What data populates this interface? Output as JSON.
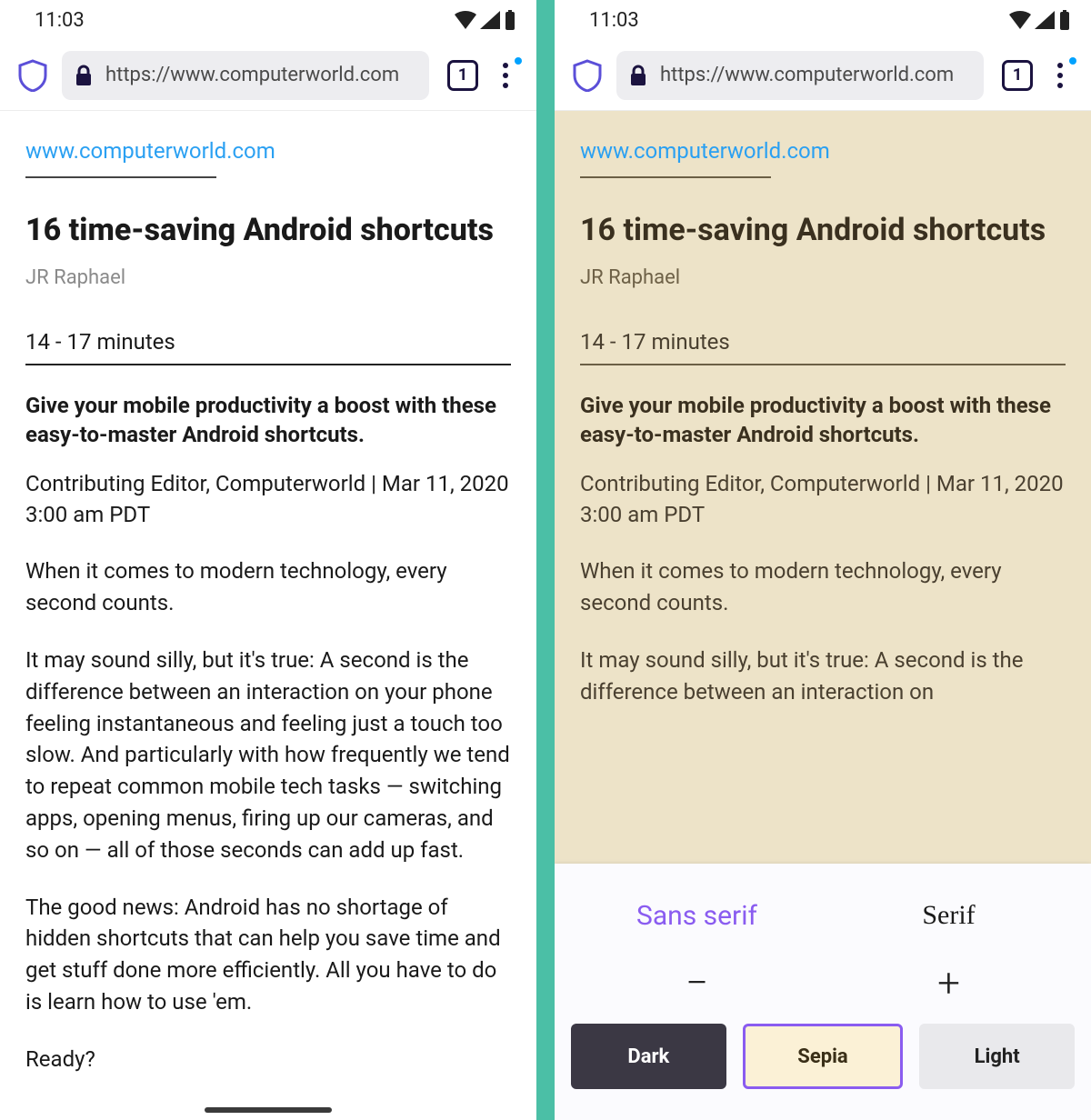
{
  "status": {
    "time": "11:03"
  },
  "toolbar": {
    "url": "https://www.computerworld.com",
    "tab_count": "1"
  },
  "article": {
    "site_link": "www.computerworld.com",
    "title": "16 time-saving Android shortcuts",
    "author": "JR Raphael",
    "read_time": "14 - 17 minutes",
    "subhead": "Give your mobile productivity a boost with these easy-to-master Android shortcuts.",
    "meta": "Contributing Editor, Computerworld | Mar 11, 2020 3:00 am PDT",
    "p1": "When it comes to modern technology, every second counts.",
    "p2": "It may sound silly, but it's true: A second is the difference between an interaction on your phone feeling instantaneous and feeling just a touch too slow. And particularly with how frequently we tend to repeat common mobile tech tasks — switching apps, opening menus, firing up our cameras, and so on — all of those seconds can add up fast.",
    "p2_short": "It may sound silly, but it's true: A second is the difference between an interaction on",
    "p3": "The good news: Android has no shortage of hidden shortcuts that can help you save time and get stuff done more efficiently. All you have to do is learn how to use 'em.",
    "p4": "Ready?"
  },
  "reader_sheet": {
    "font_sans": "Sans serif",
    "font_serif": "Serif",
    "minus": "−",
    "plus": "+",
    "themes": {
      "dark": "Dark",
      "sepia": "Sepia",
      "light": "Light"
    }
  }
}
